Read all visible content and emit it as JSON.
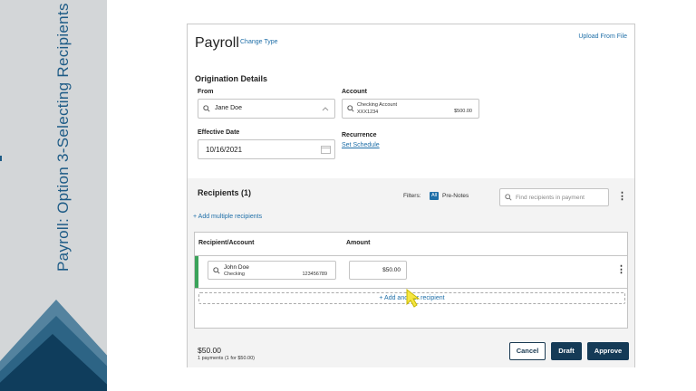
{
  "side": {
    "title": "Payroll: Option 3-Selecting Recipients"
  },
  "payroll": {
    "title": "Payroll",
    "change_type": "Change Type",
    "upload_from_file": "Upload From File",
    "origination": {
      "heading": "Origination Details",
      "from_label": "From",
      "from_value": "Jane Doe",
      "account_label": "Account",
      "account_name": "Checking Account",
      "account_number": "XXX1234",
      "account_balance": "$500.00",
      "effective_date_label": "Effective Date",
      "effective_date_value": "10/16/2021",
      "recurrence_label": "Recurrence",
      "set_schedule": "Set Schedule"
    },
    "recipients": {
      "heading": "Recipients (1)",
      "filters_label": "Filters:",
      "filter_all": "All",
      "filter_prenotes": "Pre-Notes",
      "search_placeholder": "Find recipients in payment",
      "add_multiple": "+ Add multiple recipients",
      "columns": [
        "Recipient/Account",
        "Amount"
      ],
      "rows": [
        {
          "name": "John Doe",
          "account_type": "Checking",
          "account_number": "123456789",
          "amount": "$50.00"
        }
      ],
      "add_another": "+ Add another recipient"
    },
    "footer": {
      "total": "$50.00",
      "payments_summary": "1 payments (1 for $50.00)",
      "cancel_label": "Cancel",
      "draft_label": "Draft",
      "approve_label": "Approve"
    }
  },
  "colors": {
    "accent": "#1f6fa8",
    "primary_button": "#153b57",
    "row_accent": "#3aa35a",
    "side_text": "#1d5b86",
    "cursor": "#f5e642"
  }
}
